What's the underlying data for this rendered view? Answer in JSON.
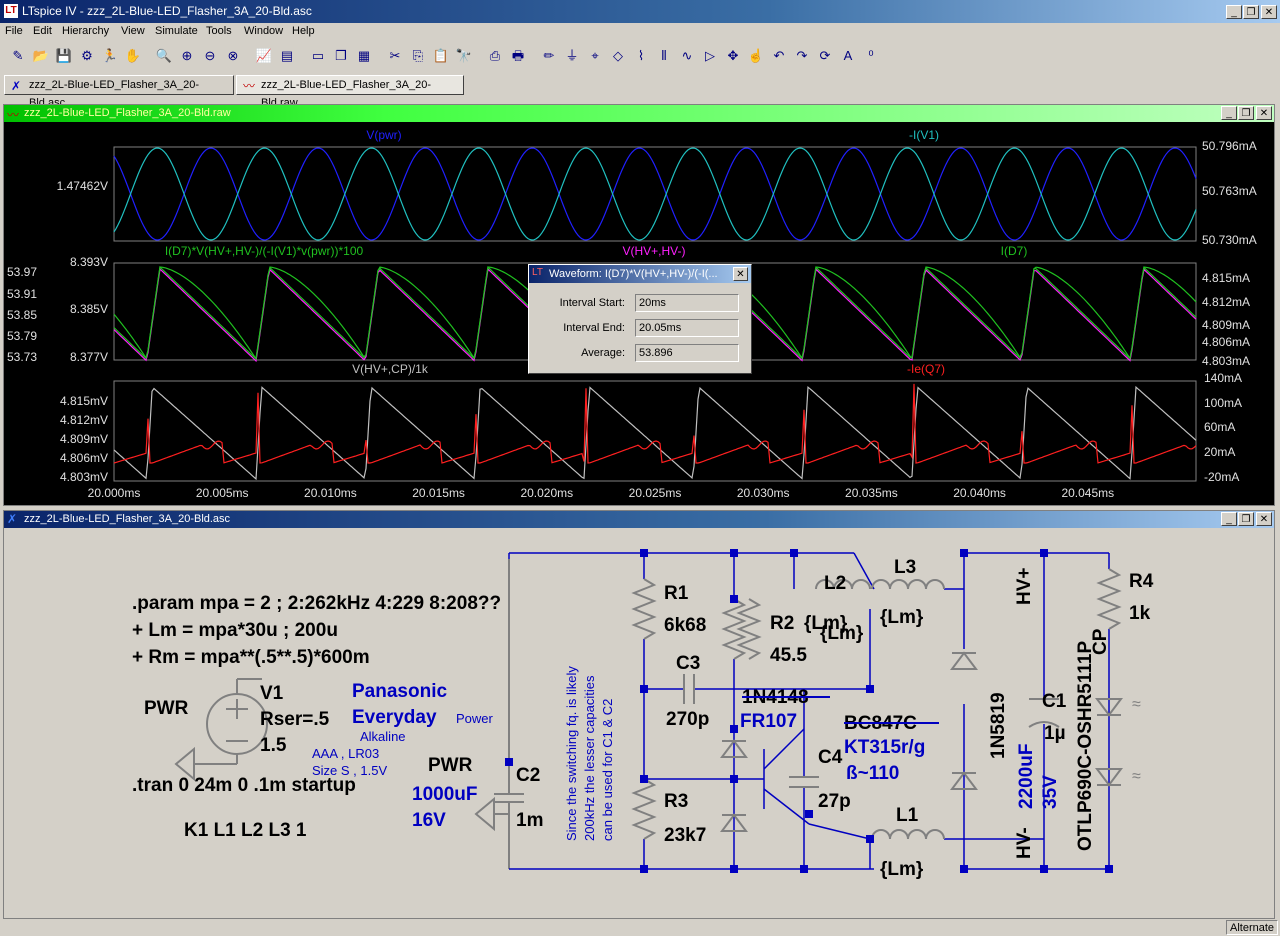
{
  "app": {
    "title": "LTspice IV - zzz_2L-Blue-LED_Flasher_3A_20-Bld.asc",
    "icon_text": "LT"
  },
  "menu": [
    "File",
    "Edit",
    "Hierarchy",
    "View",
    "Simulate",
    "Tools",
    "Window",
    "Help"
  ],
  "toolbar_icons": [
    "open-schematic-icon",
    "open-icon",
    "save-icon",
    "control-panel-icon",
    "run-icon",
    "pan-icon",
    "zoom-in-icon",
    "zoom-full-icon",
    "zoom-out-icon",
    "zoom-cancel-icon",
    "autorange-icon",
    "plot-settings-icon",
    "tile-horizontal-icon",
    "cascade-icon",
    "close-all-icon",
    "cut-icon",
    "copy-icon",
    "paste-icon",
    "find-icon",
    "print-setup-icon",
    "print-icon",
    "draw-wire-icon",
    "ground-icon",
    "label-net-icon",
    "component-icon",
    "resistor-icon",
    "capacitor-icon",
    "inductor-icon",
    "diode-icon",
    "move-icon",
    "drag-icon",
    "undo-icon",
    "redo-icon",
    "rotate-icon",
    "text-icon",
    "spice-directive-icon"
  ],
  "tabs": [
    {
      "label": "zzz_2L-Blue-LED_Flasher_3A_20-Bld.asc",
      "icon": "schematic-icon"
    },
    {
      "label": "zzz_2L-Blue-LED_Flasher_3A_20-Bld.raw",
      "icon": "waveform-icon"
    }
  ],
  "waveform_window": {
    "title": "zzz_2L-Blue-LED_Flasher_3A_20-Bld.raw",
    "pane1": {
      "traces": [
        {
          "name": "V(pwr)",
          "color": "#2020ff"
        },
        {
          "name": "-I(V1)",
          "color": "#20c0c0"
        }
      ],
      "left_ticks": [
        "1.47462V"
      ],
      "right_ticks": [
        "50.796mA",
        "50.763mA",
        "50.730mA"
      ]
    },
    "pane2": {
      "traces": [
        {
          "name": "I(D7)*V(HV+,HV-)/(-I(V1)*v(pwr))*100",
          "color": "#20c020"
        },
        {
          "name": "V(HV+,HV-)",
          "color": "#ff20ff"
        },
        {
          "name": "I(D7)",
          "color": "#20c020"
        }
      ],
      "left_ticks_outer": [
        "53.97",
        "53.91",
        "53.85",
        "53.79",
        "53.73"
      ],
      "left_ticks_inner": [
        "8.393V",
        "8.385V",
        "8.377V"
      ],
      "right_ticks": [
        "4.815mA",
        "4.812mA",
        "4.809mA",
        "4.806mA",
        "4.803mA"
      ]
    },
    "pane3": {
      "traces": [
        {
          "name": "V(HV+,CP)/1k",
          "color": "#c0c0c0"
        },
        {
          "name": "-Ie(Q7)",
          "color": "#ff2020"
        }
      ],
      "left_ticks": [
        "4.815mV",
        "4.812mV",
        "4.809mV",
        "4.806mV",
        "4.803mV"
      ],
      "right_ticks": [
        "140mA",
        "100mA",
        "60mA",
        "20mA",
        "-20mA"
      ]
    },
    "x_ticks": [
      "20.000ms",
      "20.005ms",
      "20.010ms",
      "20.015ms",
      "20.020ms",
      "20.025ms",
      "20.030ms",
      "20.035ms",
      "20.040ms",
      "20.045ms"
    ]
  },
  "dialog": {
    "title": "Waveform: I(D7)*V(HV+,HV-)/(-I(...",
    "interval_start_label": "Interval Start:",
    "interval_start": "20ms",
    "interval_end_label": "Interval End:",
    "interval_end": "20.05ms",
    "average_label": "Average:",
    "average": "53.896"
  },
  "schematic_window": {
    "title": "zzz_2L-Blue-LED_Flasher_3A_20-Bld.asc",
    "directives": [
      ".param mpa = 2 ; 2:262kHz 4:229 8:208??",
      "+ Lm = mpa*30u ; 200u",
      "+ Rm = mpa**(.5**.5)*600m",
      ".tran 0 24m 0 .1m startup",
      "K1 L1 L2 L3 1"
    ],
    "v1": {
      "name": "V1",
      "rser": "Rser=.5",
      "value": "1.5",
      "net": "PWR"
    },
    "battery_note": {
      "brand": "Panasonic",
      "line": "Everyday",
      "type": "Power",
      "chem": "Alkaline",
      "size1": "AAA , LR03",
      "size2": "Size S , 1.5V"
    },
    "c2": {
      "name": "C2",
      "value": "1m",
      "note1": "1000uF",
      "note2": "16V",
      "net": "PWR"
    },
    "vertical_note": [
      "Since the switching fq. is likely",
      "200kHz the lesser capacities",
      "can be used for C1 & C2"
    ],
    "r1": {
      "name": "R1",
      "value": "6k68"
    },
    "r2": {
      "name": "R2",
      "value": "{Lm}",
      "value2": "45.5"
    },
    "r3": {
      "name": "R3",
      "value": "23k7"
    },
    "c3": {
      "name": "C3",
      "value": "270p"
    },
    "c4": {
      "name": "C4",
      "value": "27p"
    },
    "d1": {
      "name": "1N4148",
      "alt": "FR107"
    },
    "q1": {
      "name": "BC847C",
      "alt": "KT315r/g",
      "beta": "ß~110"
    },
    "l1": {
      "name": "L1",
      "value": "{Lm}"
    },
    "l2": {
      "name": "L2",
      "value": "{Lm}"
    },
    "l3": {
      "name": "L3",
      "value": "{Lm}"
    },
    "d_sch": {
      "name": "1N5819"
    },
    "c1": {
      "name": "C1",
      "value": "1µ",
      "note1": "2200uF",
      "note2": "35V"
    },
    "nets": {
      "hvp": "HV+",
      "hvn": "HV-",
      "cp": "CP"
    },
    "r4": {
      "name": "R4",
      "value": "1k"
    },
    "led": {
      "name": "OTLP690C-OSHR5111P"
    }
  },
  "status": {
    "mode": "Alternate"
  }
}
